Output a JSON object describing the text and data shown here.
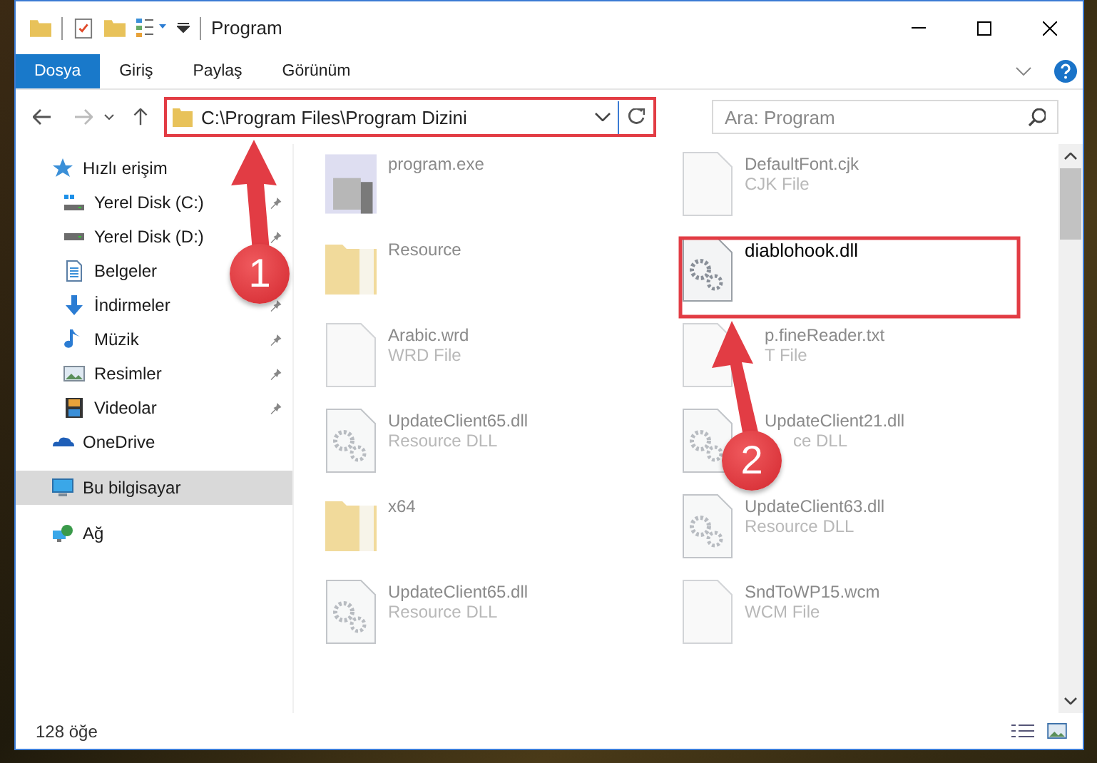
{
  "window": {
    "title": "Program"
  },
  "ribbon_tabs": [
    {
      "label": "Dosya",
      "selected": true
    },
    {
      "label": "Giriş",
      "selected": false
    },
    {
      "label": "Paylaş",
      "selected": false
    },
    {
      "label": "Görünüm",
      "selected": false
    }
  ],
  "address_bar": {
    "value": "C:\\Program Files\\Program Dizini",
    "highlighted": true
  },
  "search": {
    "placeholder": "Ara: Program"
  },
  "sidebar": [
    {
      "label": "Hızlı erişim",
      "selected": false,
      "children": [
        {
          "label": "Yerel Disk (C:)",
          "pinned": true
        },
        {
          "label": "Yerel Disk (D:)",
          "pinned": true
        },
        {
          "label": "Belgeler",
          "pinned": false
        },
        {
          "label": "İndirmeler",
          "pinned": true
        },
        {
          "label": "Müzik",
          "pinned": true
        },
        {
          "label": "Resimler",
          "pinned": true
        },
        {
          "label": "Videolar",
          "pinned": true
        }
      ]
    },
    {
      "label": "OneDrive",
      "selected": false
    },
    {
      "label": "Bu bilgisayar",
      "selected": true
    },
    {
      "label": "Ağ",
      "selected": false
    }
  ],
  "files": [
    {
      "name": "program.exe",
      "kind": "exe",
      "highlighted": false
    },
    {
      "name": "DefaultFont.cjk",
      "type": "CJK File",
      "kind": "file",
      "highlighted": false
    },
    {
      "name": "Resource",
      "kind": "folder",
      "highlighted": false
    },
    {
      "name": "diablohook.dll",
      "kind": "dll",
      "highlighted": true
    },
    {
      "name": "Arabic.wrd",
      "type": "WRD File",
      "kind": "file",
      "highlighted": false
    },
    {
      "name": "p.fineReader.txt",
      "type": "T File",
      "kind": "file",
      "highlighted": false
    },
    {
      "name": "UpdateClient65.dll",
      "type": "Resource DLL",
      "kind": "dll",
      "highlighted": false
    },
    {
      "name": "UpdateClient21.dll",
      "type": "ce DLL",
      "kind": "dll",
      "highlighted": false
    },
    {
      "name": "x64",
      "kind": "folder",
      "highlighted": false
    },
    {
      "name": "UpdateClient63.dll",
      "type": "Resource DLL",
      "kind": "dll",
      "highlighted": false
    },
    {
      "name": "UpdateClient65.dll",
      "type": "Resource DLL",
      "kind": "dll",
      "highlighted": false
    },
    {
      "name": "SndToWP15.wcm",
      "type": "WCM File",
      "kind": "file",
      "highlighted": false
    }
  ],
  "status_bar": {
    "count": "128 öğe"
  },
  "annotations": [
    {
      "number": "1"
    },
    {
      "number": "2"
    }
  ]
}
